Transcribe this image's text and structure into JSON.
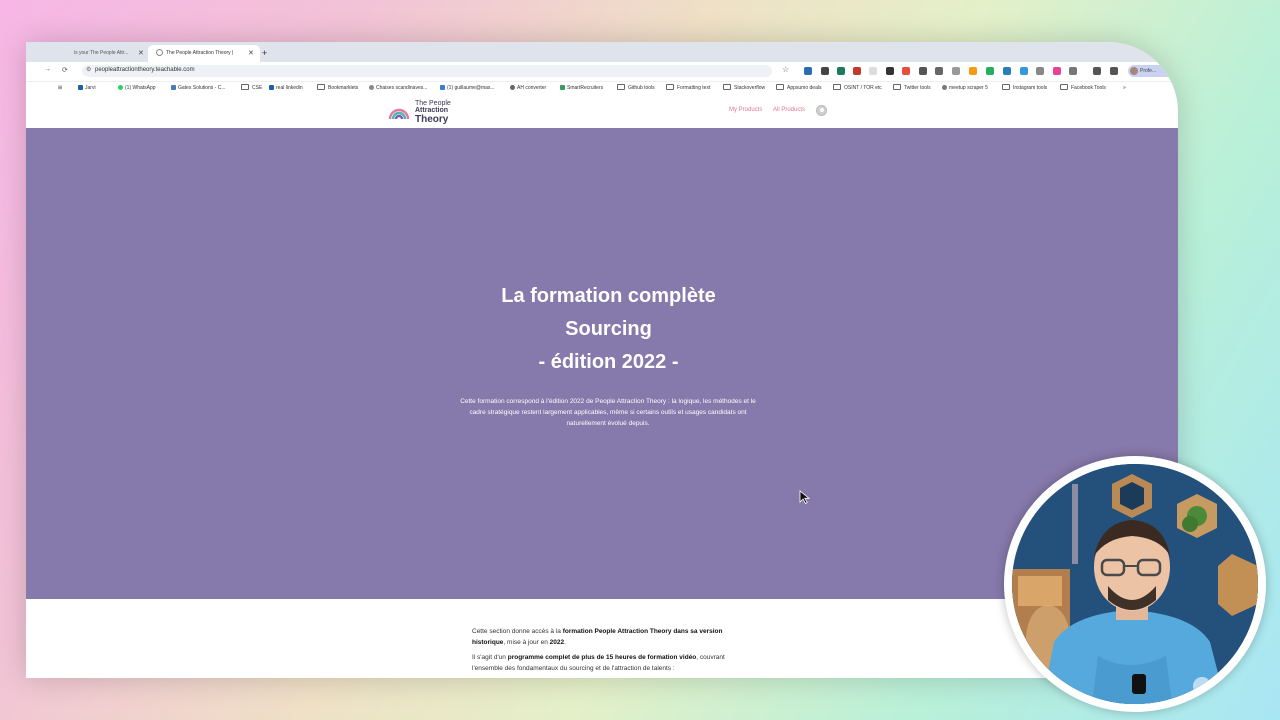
{
  "browser": {
    "tabs": [
      {
        "label": "is your The People Attr...",
        "active": false
      },
      {
        "label": "The People Attraction Theory |",
        "active": true
      }
    ],
    "new_tab": "+",
    "url": "peopleattractiontheory.teachable.com",
    "bookmarks": [
      {
        "label": "Jarvi",
        "icon": "linkedin-icon"
      },
      {
        "label": "(1) WhatsApp",
        "icon": "whatsapp-icon"
      },
      {
        "label": "Gates Solutions - C...",
        "icon": "site-icon"
      },
      {
        "label": "CSE",
        "icon": "folder-icon"
      },
      {
        "label": "real linkedin",
        "icon": "linkedin-icon"
      },
      {
        "label": "Bookmarklets",
        "icon": "folder-icon"
      },
      {
        "label": "Chaises scandinaves...",
        "icon": "site-icon"
      },
      {
        "label": "(1) guillaume@mas...",
        "icon": "site-icon"
      },
      {
        "label": "AH converter",
        "icon": "site-icon"
      },
      {
        "label": "SmartRecruiters",
        "icon": "site-icon"
      },
      {
        "label": "Github tools",
        "icon": "folder-icon"
      },
      {
        "label": "Formatting text",
        "icon": "folder-icon"
      },
      {
        "label": "Stackoverflow",
        "icon": "folder-icon"
      },
      {
        "label": "Appsumo deals",
        "icon": "folder-icon"
      },
      {
        "label": "OSINT / TOR etc",
        "icon": "folder-icon"
      },
      {
        "label": "Twitter tools",
        "icon": "folder-icon"
      },
      {
        "label": "meetup scraper 5",
        "icon": "site-icon"
      },
      {
        "label": "Instagram tools",
        "icon": "folder-icon"
      },
      {
        "label": "Facebook Tools",
        "icon": "folder-icon"
      }
    ],
    "profile_label": "Profe..."
  },
  "site": {
    "logo": {
      "line1": "The People",
      "line2": "Attraction",
      "line3": "Theory"
    },
    "nav": {
      "my_products": "My Products",
      "all_products": "All Products"
    }
  },
  "hero": {
    "title_lines": [
      "La formation complète",
      "Sourcing",
      "- édition 2022 -"
    ],
    "description": "Cette formation correspond à l'édition 2022 de People Attraction Theory : la logique, les méthodes et le cadre stratégique restent largement applicables, même si certains outils et usages candidats ont naturellement évolué depuis."
  },
  "content": {
    "p1_pre": "Cette section donne accès à la ",
    "p1_bold1": "formation People Attraction Theory dans sa version historique",
    "p1_mid": ", mise à jour en ",
    "p1_bold2": "2022",
    "p1_end": ".",
    "p2_pre": "Il s'agit d'un ",
    "p2_bold": "programme complet de plus de 15 heures de formation vidéo",
    "p2_end": ", couvrant l'ensemble des fondamentaux du sourcing et de l'attraction de talents :"
  },
  "colors": {
    "hero_bg": "#8679ab",
    "nav_link": "#e0788d"
  }
}
